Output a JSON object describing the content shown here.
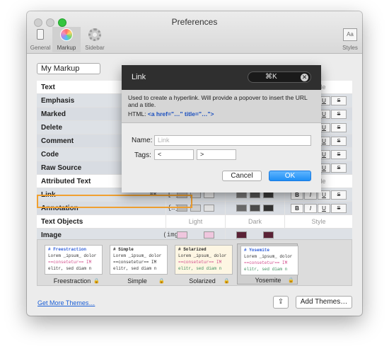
{
  "window": {
    "title": "Preferences"
  },
  "toolbar": {
    "items": [
      {
        "label": "General",
        "icon": "phone-icon"
      },
      {
        "label": "Markup",
        "icon": "color-wheel-icon"
      },
      {
        "label": "Sidebar",
        "icon": "gear-icon"
      },
      {
        "label": "Styles",
        "icon": "styles-icon"
      }
    ],
    "styles_glyph": "Aa"
  },
  "markup_select": {
    "value": "My Markup"
  },
  "table": {
    "header": {
      "name": "Text",
      "style": "Style",
      "strike": "S"
    },
    "rows": [
      {
        "name": "Emphasis",
        "light": [
          "#e2e2e2",
          "#e2e2e2",
          "#e2e2e2"
        ],
        "dark": [
          "#4a4a4a",
          "#4a4a4a",
          "#4a4a4a"
        ]
      },
      {
        "name": "Marked",
        "light": [
          "#e2e2e2",
          "#e2e2e2",
          "#e2e2e2"
        ],
        "dark": [
          "#4a4a4a",
          "#4a4a4a",
          "#4a4a4a"
        ]
      },
      {
        "name": "Delete",
        "light": [
          "#e2e2e2",
          "#e2e2e2",
          "#e2e2e2"
        ],
        "dark": [
          "#4a4a4a",
          "#4a4a4a",
          "#4a4a4a"
        ]
      },
      {
        "name": "Comment",
        "light": [
          "#e2e2e2",
          "#e2e2e2",
          "#e2e2e2"
        ],
        "dark": [
          "#4a4a4a",
          "#4a4a4a",
          "#4a4a4a"
        ]
      },
      {
        "name": "Code",
        "light": [
          "#e2e2e2",
          "#e2e2e2",
          "#e2e2e2"
        ],
        "dark": [
          "#4a4a4a",
          "#4a4a4a",
          "#4a4a4a"
        ]
      },
      {
        "name": "Raw Source",
        "light": [
          "#e2e2e2",
          "#e2e2e2",
          "#e2e2e2"
        ],
        "dark": [
          "#4a4a4a",
          "#4a4a4a",
          "#4a4a4a"
        ]
      }
    ],
    "attributed": {
      "section": "Attributed Text",
      "style": "Style",
      "link": {
        "name": "Link",
        "shortcut": "⌘K",
        "syntax": "[…]"
      },
      "annotation": {
        "name": "Annotation",
        "syntax": "{…}"
      }
    },
    "objects": {
      "section": "Text Objects",
      "light": "Light",
      "dark": "Dark",
      "style": "Style",
      "image": {
        "name": "Image",
        "syntax": "(img)"
      }
    },
    "style_buttons": {
      "b": "B",
      "i": "I",
      "u": "U",
      "s": "S"
    }
  },
  "themes": [
    {
      "name": "Freestraction",
      "head": "# Freestraction"
    },
    {
      "name": "Simple",
      "head": "# Simple"
    },
    {
      "name": "Solarized",
      "head": "# Solarized"
    },
    {
      "name": "Yosemite",
      "head": "# Yosemite"
    }
  ],
  "theme_preview": {
    "line1": "Lorem _ipsum_ dolor",
    "line2": "==consetetur== IM",
    "line3": "elitr, sed diam n"
  },
  "footer": {
    "get_more": "Get More Themes…",
    "add_themes": "Add Themes…",
    "share_glyph": "⇪"
  },
  "sheet": {
    "title": "Link",
    "shortcut": "⌘K",
    "close_glyph": "✕",
    "description": "Used to create a hyperlink. Will provide a popover to insert the URL and a title.",
    "html_label": "HTML:",
    "html_code": "<a href=\"…\" title=\"…\">",
    "name_label": "Name:",
    "name_placeholder": "Link",
    "tags_label": "Tags:",
    "tag_open": "<",
    "tag_close": ">",
    "cancel": "Cancel",
    "ok": "OK"
  },
  "colors": {
    "selection": "#f0a030",
    "accent": "#1f8ef5",
    "link": "#1a5ed6"
  }
}
